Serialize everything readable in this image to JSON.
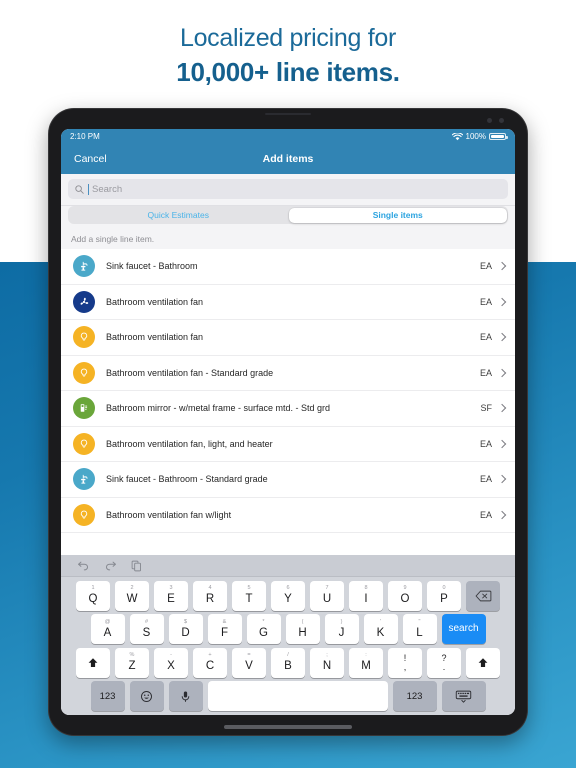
{
  "marketing": {
    "line1": "Localized pricing for",
    "line2": "10,000+ line items.",
    "text_color": "#17618f",
    "bg_top": "#ffffff",
    "bg_blue": "#1678ae"
  },
  "status_bar": {
    "time": "2:10 PM",
    "wifi_icon": "wifi-icon",
    "battery_percent": "100%",
    "battery_icon": "battery-full-icon",
    "bg_color": "#3184b4"
  },
  "nav_bar": {
    "cancel_label": "Cancel",
    "title": "Add items",
    "bg_color": "#3184b4"
  },
  "search": {
    "placeholder": "Search",
    "value": "",
    "icon": "search-icon"
  },
  "segmented": {
    "options": [
      {
        "label": "Quick Estimates",
        "selected": false
      },
      {
        "label": "Single items",
        "selected": true
      }
    ],
    "accent_color": "#2aa3e0"
  },
  "section": {
    "header": "Add a single line item."
  },
  "list": {
    "items": [
      {
        "label": "Sink faucet - Bathroom",
        "unit": "EA",
        "icon": "faucet-icon",
        "icon_color": "#4aa8c9"
      },
      {
        "label": "Bathroom ventilation fan",
        "unit": "EA",
        "icon": "fan-icon",
        "icon_color": "#153a8a"
      },
      {
        "label": "Bathroom ventilation fan",
        "unit": "EA",
        "icon": "lightbulb-icon",
        "icon_color": "#f5b324"
      },
      {
        "label": "Bathroom ventilation fan - Standard grade",
        "unit": "EA",
        "icon": "lightbulb-icon",
        "icon_color": "#f5b324"
      },
      {
        "label": "Bathroom mirror - w/metal frame - surface mtd. - Std grd",
        "unit": "SF",
        "icon": "mirror-icon",
        "icon_color": "#6aa63a"
      },
      {
        "label": "Bathroom ventilation fan, light, and heater",
        "unit": "EA",
        "icon": "lightbulb-icon",
        "icon_color": "#f5b324"
      },
      {
        "label": "Sink faucet - Bathroom - Standard grade",
        "unit": "EA",
        "icon": "faucet-icon",
        "icon_color": "#4aa8c9"
      },
      {
        "label": "Bathroom ventilation fan w/light",
        "unit": "EA",
        "icon": "lightbulb-icon",
        "icon_color": "#f5b324"
      }
    ],
    "chevron_icon": "chevron-right-icon"
  },
  "keyboard": {
    "toolbar": [
      {
        "icon": "undo-icon"
      },
      {
        "icon": "redo-icon"
      },
      {
        "icon": "copy-paste-icon"
      }
    ],
    "row1": [
      {
        "main": "Q",
        "alt": "1"
      },
      {
        "main": "W",
        "alt": "2"
      },
      {
        "main": "E",
        "alt": "3"
      },
      {
        "main": "R",
        "alt": "4"
      },
      {
        "main": "T",
        "alt": "5"
      },
      {
        "main": "Y",
        "alt": "6"
      },
      {
        "main": "U",
        "alt": "7"
      },
      {
        "main": "I",
        "alt": "8"
      },
      {
        "main": "O",
        "alt": "9"
      },
      {
        "main": "P",
        "alt": "0"
      }
    ],
    "backspace_icon": "backspace-icon",
    "row2": [
      {
        "main": "A",
        "alt": "@"
      },
      {
        "main": "S",
        "alt": "#"
      },
      {
        "main": "D",
        "alt": "$"
      },
      {
        "main": "F",
        "alt": "&"
      },
      {
        "main": "G",
        "alt": "*"
      },
      {
        "main": "H",
        "alt": "("
      },
      {
        "main": "J",
        "alt": ")"
      },
      {
        "main": "K",
        "alt": "'"
      },
      {
        "main": "L",
        "alt": "\""
      }
    ],
    "search_key_label": "search",
    "search_key_color": "#1a8cf5",
    "row3": [
      {
        "main": "Z",
        "alt": "%"
      },
      {
        "main": "X",
        "alt": "-"
      },
      {
        "main": "C",
        "alt": "+"
      },
      {
        "main": "V",
        "alt": "="
      },
      {
        "main": "B",
        "alt": "/"
      },
      {
        "main": "N",
        "alt": ";"
      },
      {
        "main": "M",
        "alt": ":"
      }
    ],
    "punct1": {
      "main": "!",
      "sub": ","
    },
    "punct2": {
      "main": "?",
      "sub": "."
    },
    "shift_icon": "shift-icon",
    "row4": {
      "numeric_left": "123",
      "emoji_icon": "emoji-icon",
      "mic_icon": "microphone-icon",
      "space_label": "",
      "numeric_right": "123",
      "dismiss_icon": "keyboard-dismiss-icon"
    }
  }
}
